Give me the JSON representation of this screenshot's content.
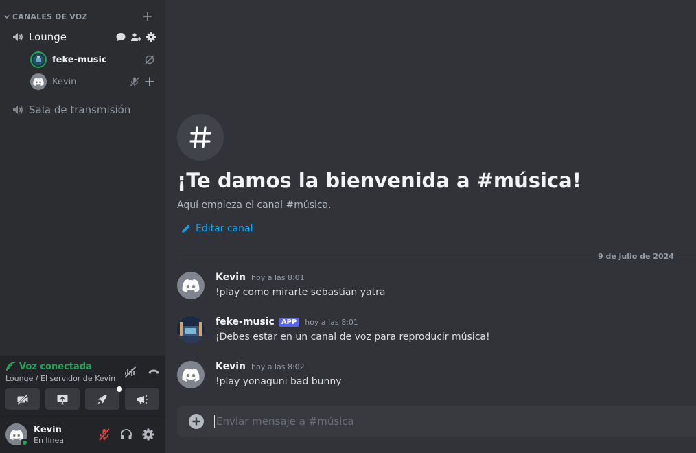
{
  "sidebar": {
    "category": {
      "label": "CANALES DE VOZ",
      "icon_collapse": "chevron-down-icon",
      "icon_add": "plus-icon"
    },
    "channels": [
      {
        "name": "Lounge",
        "icon": "speaker-icon",
        "active": true,
        "actions": [
          "chat-bubble-icon",
          "add-member-icon",
          "gear-icon"
        ],
        "users": [
          {
            "name": "feke-music",
            "icons": [
              "deafen-video-off-icon"
            ]
          },
          {
            "name": "Kevin",
            "icons": [
              "mic-muted-icon",
              "plus-icon"
            ]
          }
        ]
      },
      {
        "name": "Sala de transmisión",
        "icon": "speaker-icon",
        "active": false
      }
    ]
  },
  "voice_panel": {
    "status": "Voz conectada",
    "location": "Lounge / El servidor de Kevin",
    "status_color": "#23a559",
    "buttons": [
      "camera-off-icon",
      "screen-share-icon",
      "rocket-activity-icon",
      "soundboard-icon"
    ]
  },
  "user_bar": {
    "name": "Kevin",
    "status": "En línea",
    "icons": [
      "mic-muted-icon",
      "headphones-icon",
      "gear-icon"
    ]
  },
  "main": {
    "welcome_title": "¡Te damos la bienvenida a #música!",
    "welcome_sub": "Aquí empieza el canal #música.",
    "edit_label": "Editar canal",
    "date_divider": "9 de julio de 2024",
    "messages": [
      {
        "author": "Kevin",
        "time": "hoy a las 8:01",
        "text": "!play como mirarte sebastian yatra",
        "bot": false
      },
      {
        "author": "feke-music",
        "tag": "APP",
        "time": "hoy a las 8:01",
        "text": "¡Debes estar en un canal de voz para reproducir música!",
        "bot": true
      },
      {
        "author": "Kevin",
        "time": "hoy a las 8:02",
        "text": "!play yonaguni bad bunny",
        "bot": false
      }
    ],
    "composer_placeholder": "Enviar mensaje a #música"
  },
  "colors": {
    "accent": "#5865f2",
    "link": "#00a8fc",
    "danger": "#f23f43",
    "online": "#23a559"
  }
}
